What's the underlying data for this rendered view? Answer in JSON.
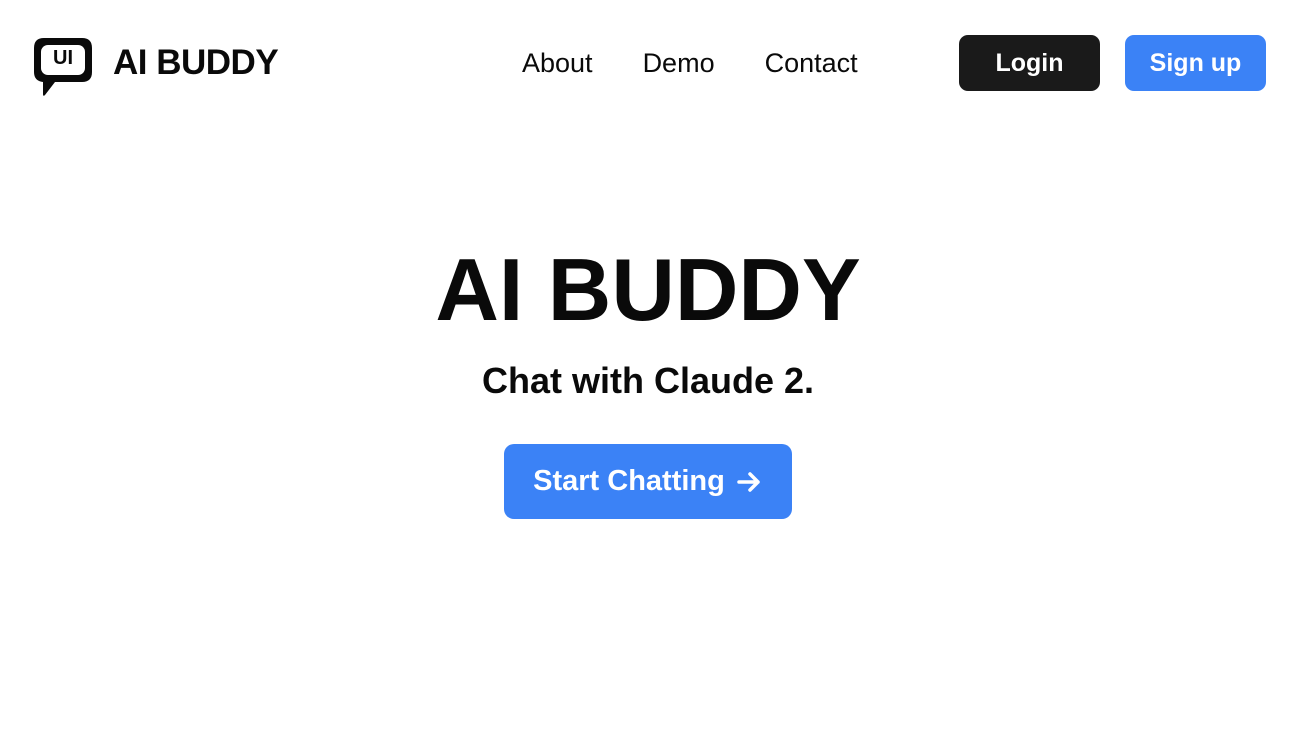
{
  "header": {
    "logo_text": "UI",
    "brand_name": "AI BUDDY",
    "nav": [
      {
        "label": "About"
      },
      {
        "label": "Demo"
      },
      {
        "label": "Contact"
      }
    ],
    "login_label": "Login",
    "signup_label": "Sign up"
  },
  "hero": {
    "title": "AI BUDDY",
    "subtitle": "Chat with Claude 2.",
    "cta_label": "Start Chatting",
    "cta_icon": "arrow-right-icon"
  },
  "colors": {
    "accent": "#3b82f6",
    "dark_button": "#1a1a1a",
    "text": "#0a0a0a",
    "background": "#ffffff"
  }
}
